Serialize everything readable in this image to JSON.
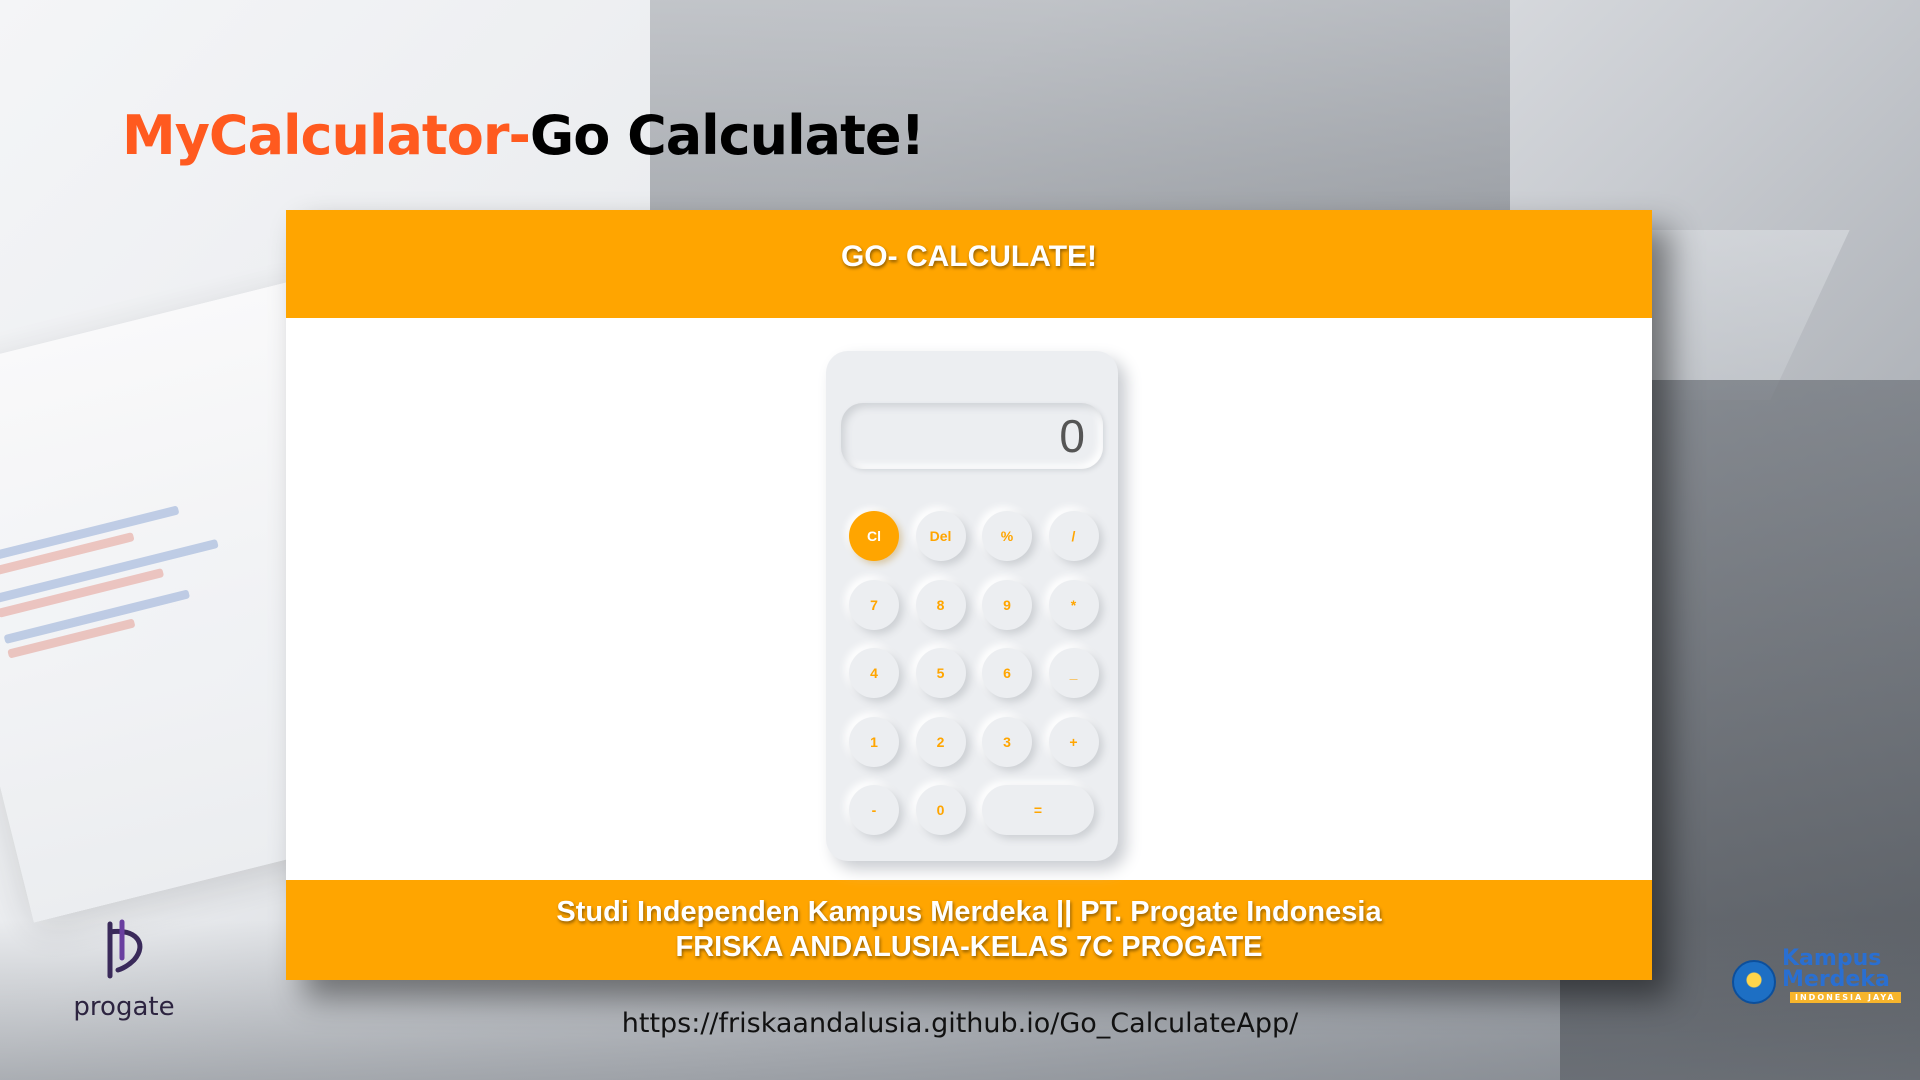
{
  "slide": {
    "title_accent": "MyCalculator-",
    "title_main": "Go Calculate!",
    "url": "https://friskaandalusia.github.io/Go_CalculateApp/"
  },
  "app": {
    "header_title": "GO- CALCULATE!",
    "display_value": "0",
    "keys": [
      [
        "Cl",
        "Del",
        "%",
        "/"
      ],
      [
        "7",
        "8",
        "9",
        "*"
      ],
      [
        "4",
        "5",
        "6",
        "_"
      ],
      [
        "1",
        "2",
        "3",
        "+"
      ],
      [
        "-",
        "0",
        "="
      ]
    ],
    "footer_line1": "Studi Independen Kampus Merdeka || PT. Progate Indonesia",
    "footer_line2": "FRISKA ANDALUSIA-KELAS 7C PROGATE"
  },
  "logos": {
    "progate_word": "progate",
    "kampus_merdeka_line1": "Kampus",
    "kampus_merdeka_line2": "Merdeka",
    "kampus_merdeka_sub": "INDONESIA JAYA"
  },
  "colors": {
    "accent_orange": "#ffa500",
    "title_orange": "#ff5a1f",
    "calc_surface": "#eceef1"
  }
}
